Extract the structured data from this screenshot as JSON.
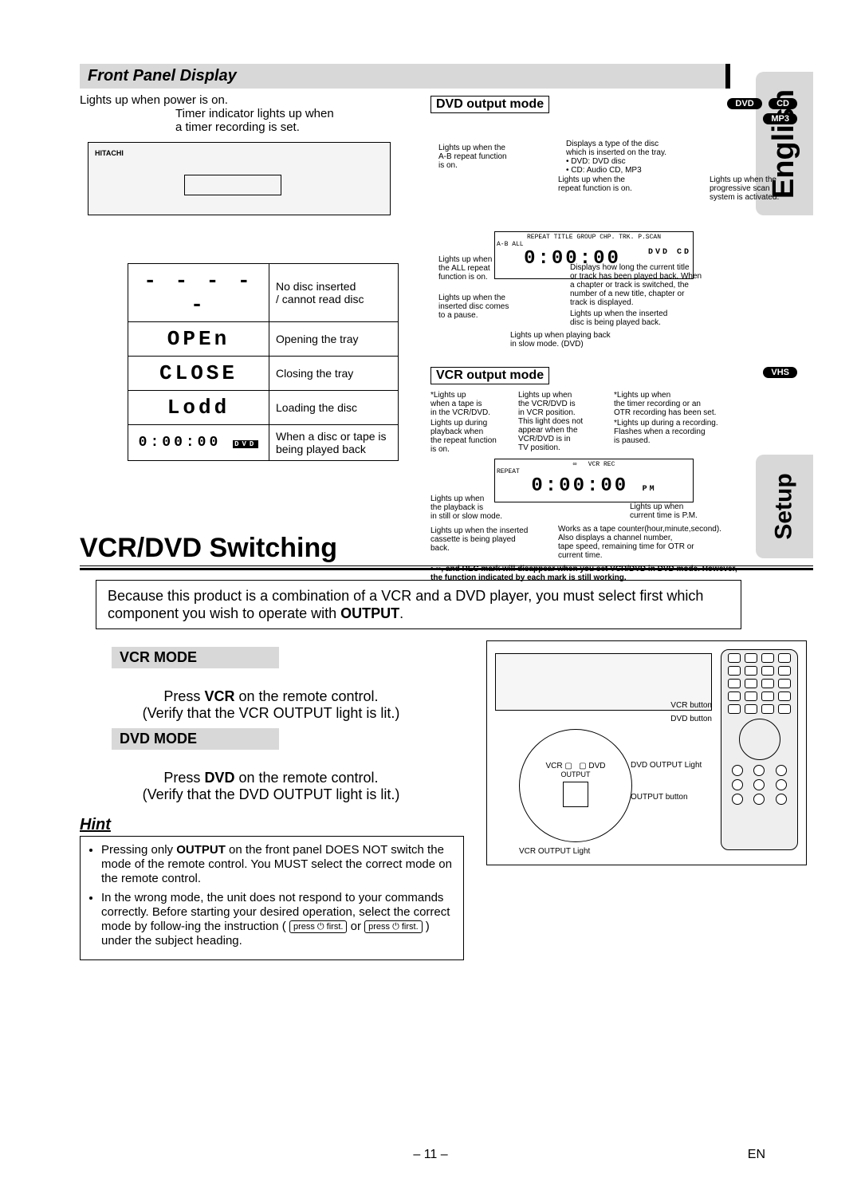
{
  "side_tabs": {
    "english": "English",
    "setup": "Setup"
  },
  "section1": {
    "title": "Front Panel Display",
    "power_caption": "Lights up when power is on.",
    "timer_caption": "Timer indicator lights up when\na timer recording is set."
  },
  "display_states": [
    {
      "seg": "- - - - -",
      "desc": "No disc inserted\n/ cannot read disc"
    },
    {
      "seg": "OPEn",
      "desc": "Opening the tray"
    },
    {
      "seg": "CLOSE",
      "desc": "Closing the tray"
    },
    {
      "seg": "Lodd",
      "desc": "Loading the disc"
    },
    {
      "seg": "0:00:00",
      "desc": "When a disc or tape is\nbeing played back"
    }
  ],
  "dvd_mode": {
    "heading": "DVD output mode",
    "badges": [
      "DVD",
      "CD",
      "MP3"
    ],
    "lcd_top_labels": "REPEAT  TITLE GROUP  CHP. TRK.  P.SCAN",
    "lcd_sub_labels": "A-B  ALL",
    "lcd_digits": "0:00:00",
    "lcd_side": "DVD  CD",
    "annotations": {
      "ab": "Lights up when the\nA-B repeat function\nis on.",
      "repeat": "Lights up when the\nrepeat function is on.",
      "disc_type": "Displays a type of the disc\nwhich is inserted on the tray.\n• DVD: DVD disc\n• CD: Audio CD, MP3",
      "pscan": "Lights up when the\nprogressive scan\nsystem is activated.",
      "all": "Lights up when\nthe ALL repeat\nfunction is on.",
      "pause": "Lights up when the\ninserted disc comes\nto a pause.",
      "time": "Displays how long the current title\nor track has been played back. When\na chapter or track is switched, the\nnumber of a new title, chapter or\ntrack is displayed.",
      "playing": "Lights up when the inserted\ndisc is being played back.",
      "slow": "Lights up when playing back\nin slow mode. (DVD)"
    }
  },
  "vcr_mode": {
    "heading": "VCR output mode",
    "badge": "VHS",
    "lcd_labels": "VCR  REC",
    "lcd_repeat": "REPEAT",
    "lcd_digits": "0:00:00",
    "lcd_pm": "PM",
    "annotations": {
      "tape_in": "*Lights up\nwhen a tape is\nin the VCR/DVD.",
      "repeat": "Lights up during\nplayback when\nthe repeat function\nis on.",
      "vcr_pos": "Lights up when\nthe VCR/DVD is\nin VCR position.\nThis light does not\nappear when the\nVCR/DVD is in\nTV position.",
      "otr": "*Lights up when\nthe timer recording or an\nOTR recording has been set.",
      "rec": "*Lights up during a recording.\nFlashes when a recording\nis paused.",
      "still": "Lights up when\nthe playback is\nin still or slow mode.",
      "cassette_play": "Lights up when the inserted\ncassette is being played\nback.",
      "pm": "Lights up when\ncurrent time is P.M.",
      "counter": "Works as a tape counter(hour,minute,second).\nAlso displays a channel number,\ntape speed, remaining time for OTR or\ncurrent time."
    },
    "footnote": ", and REC mark will disappear when you set VCR/DVD in DVD mode. However, the function indicated by each mark is still working."
  },
  "switching": {
    "heading": "VCR/DVD Switching",
    "intro": "Because this product is a combination of a VCR and a DVD player, you must select first which component you wish to operate with ",
    "intro_bold": "OUTPUT",
    "vcr_mode_bar": "VCR MODE",
    "vcr_mode_text_a": "Press ",
    "vcr_mode_text_b": "VCR",
    "vcr_mode_text_c": " on the remote control.\n(Verify that the VCR OUTPUT light is lit.)",
    "dvd_mode_bar": "DVD MODE",
    "dvd_mode_text_a": "Press ",
    "dvd_mode_text_b": "DVD",
    "dvd_mode_text_c": " on the remote control.\n(Verify that the DVD OUTPUT light is lit.)",
    "hint_head": "Hint",
    "hint_items": [
      {
        "pre": "Pressing only ",
        "bold": "OUTPUT",
        "post": " on the front panel DOES NOT switch the mode of the remote control. You MUST select the correct mode on the remote control."
      },
      {
        "pre": "In the wrong mode, the unit does not respond to your commands correctly. Before starting your desired operation, select the correct mode by follow-ing the instruction ( ",
        "key1": "press ⏻ first.",
        "mid": " or ",
        "key2": "press ⏻ first.",
        "post": " ) under the subject heading."
      }
    ],
    "diagram_labels": {
      "vcr_btn": "VCR button",
      "dvd_btn": "DVD button",
      "vcr_light": "VCR OUTPUT Light",
      "dvd_light": "DVD OUTPUT Light",
      "output_btn": "OUTPUT button",
      "vcr": "VCR",
      "dvd": "DVD",
      "output": "OUTPUT"
    }
  },
  "footer": {
    "page": "– 11 –",
    "lang": "EN"
  }
}
